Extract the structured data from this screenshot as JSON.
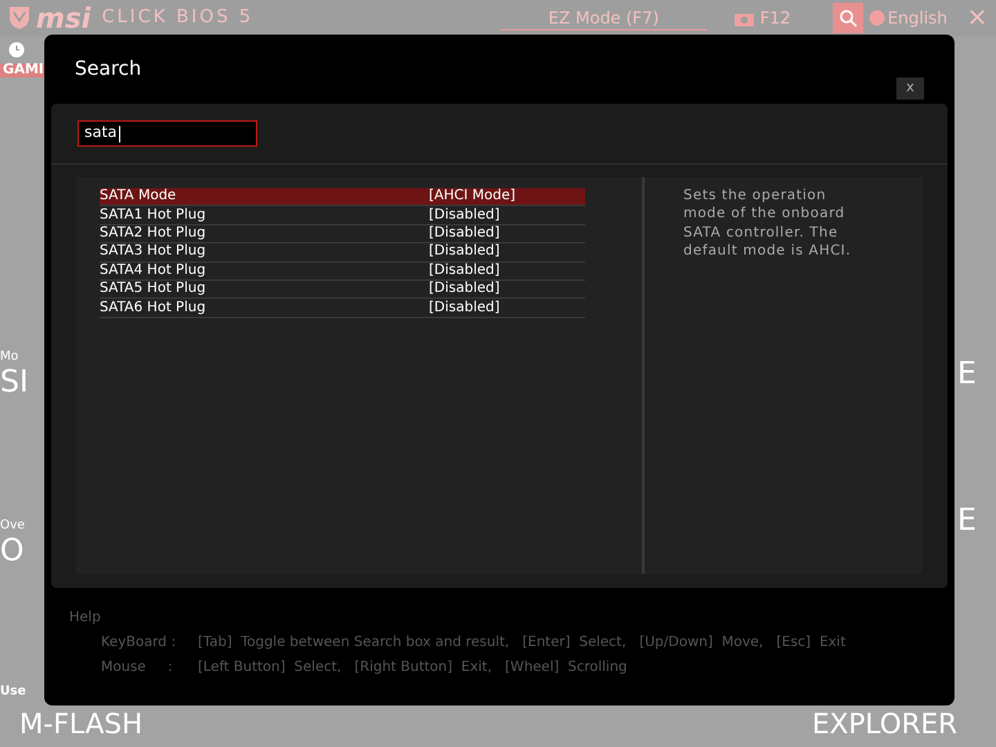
{
  "top_bar": {
    "logo_brand": "msi",
    "logo_text": "CLICK BIOS 5",
    "mode_button": "EZ Mode (F7)",
    "screenshot_key": "F12",
    "language": "English",
    "close": "×"
  },
  "left_edge_tiles": [
    "GAMI",
    "Mo",
    "SI",
    "Ove",
    "O",
    "Use"
  ],
  "right_edge_tiles": [
    "E",
    "E"
  ],
  "bottom_tiles": [
    "M-FLASH",
    "EXPLORER"
  ],
  "dialog": {
    "title": "Search",
    "close": "x",
    "search": {
      "value": "sata"
    },
    "results": [
      {
        "name": "SATA Mode",
        "value": "[AHCI Mode]",
        "selected": true
      },
      {
        "name": "SATA1 Hot Plug",
        "value": "[Disabled]",
        "selected": false
      },
      {
        "name": "SATA2 Hot Plug",
        "value": "[Disabled]",
        "selected": false
      },
      {
        "name": "SATA3 Hot Plug",
        "value": "[Disabled]",
        "selected": false
      },
      {
        "name": "SATA4 Hot Plug",
        "value": "[Disabled]",
        "selected": false
      },
      {
        "name": "SATA5 Hot Plug",
        "value": "[Disabled]",
        "selected": false
      },
      {
        "name": "SATA6 Hot Plug",
        "value": "[Disabled]",
        "selected": false
      }
    ],
    "description": "Sets the operation mode of the onboard SATA controller. The default mode is AHCI.",
    "help": {
      "title": "Help",
      "lines": [
        {
          "label": "KeyBoard :",
          "text": "[Tab]  Toggle between Search box and result,   [Enter]  Select,   [Up/Down]  Move,   [Esc]  Exit"
        },
        {
          "label": "Mouse     :",
          "text": "[Left Button]  Select,   [Right Button]  Exit,   [Wheel]  Scrolling"
        }
      ]
    }
  }
}
